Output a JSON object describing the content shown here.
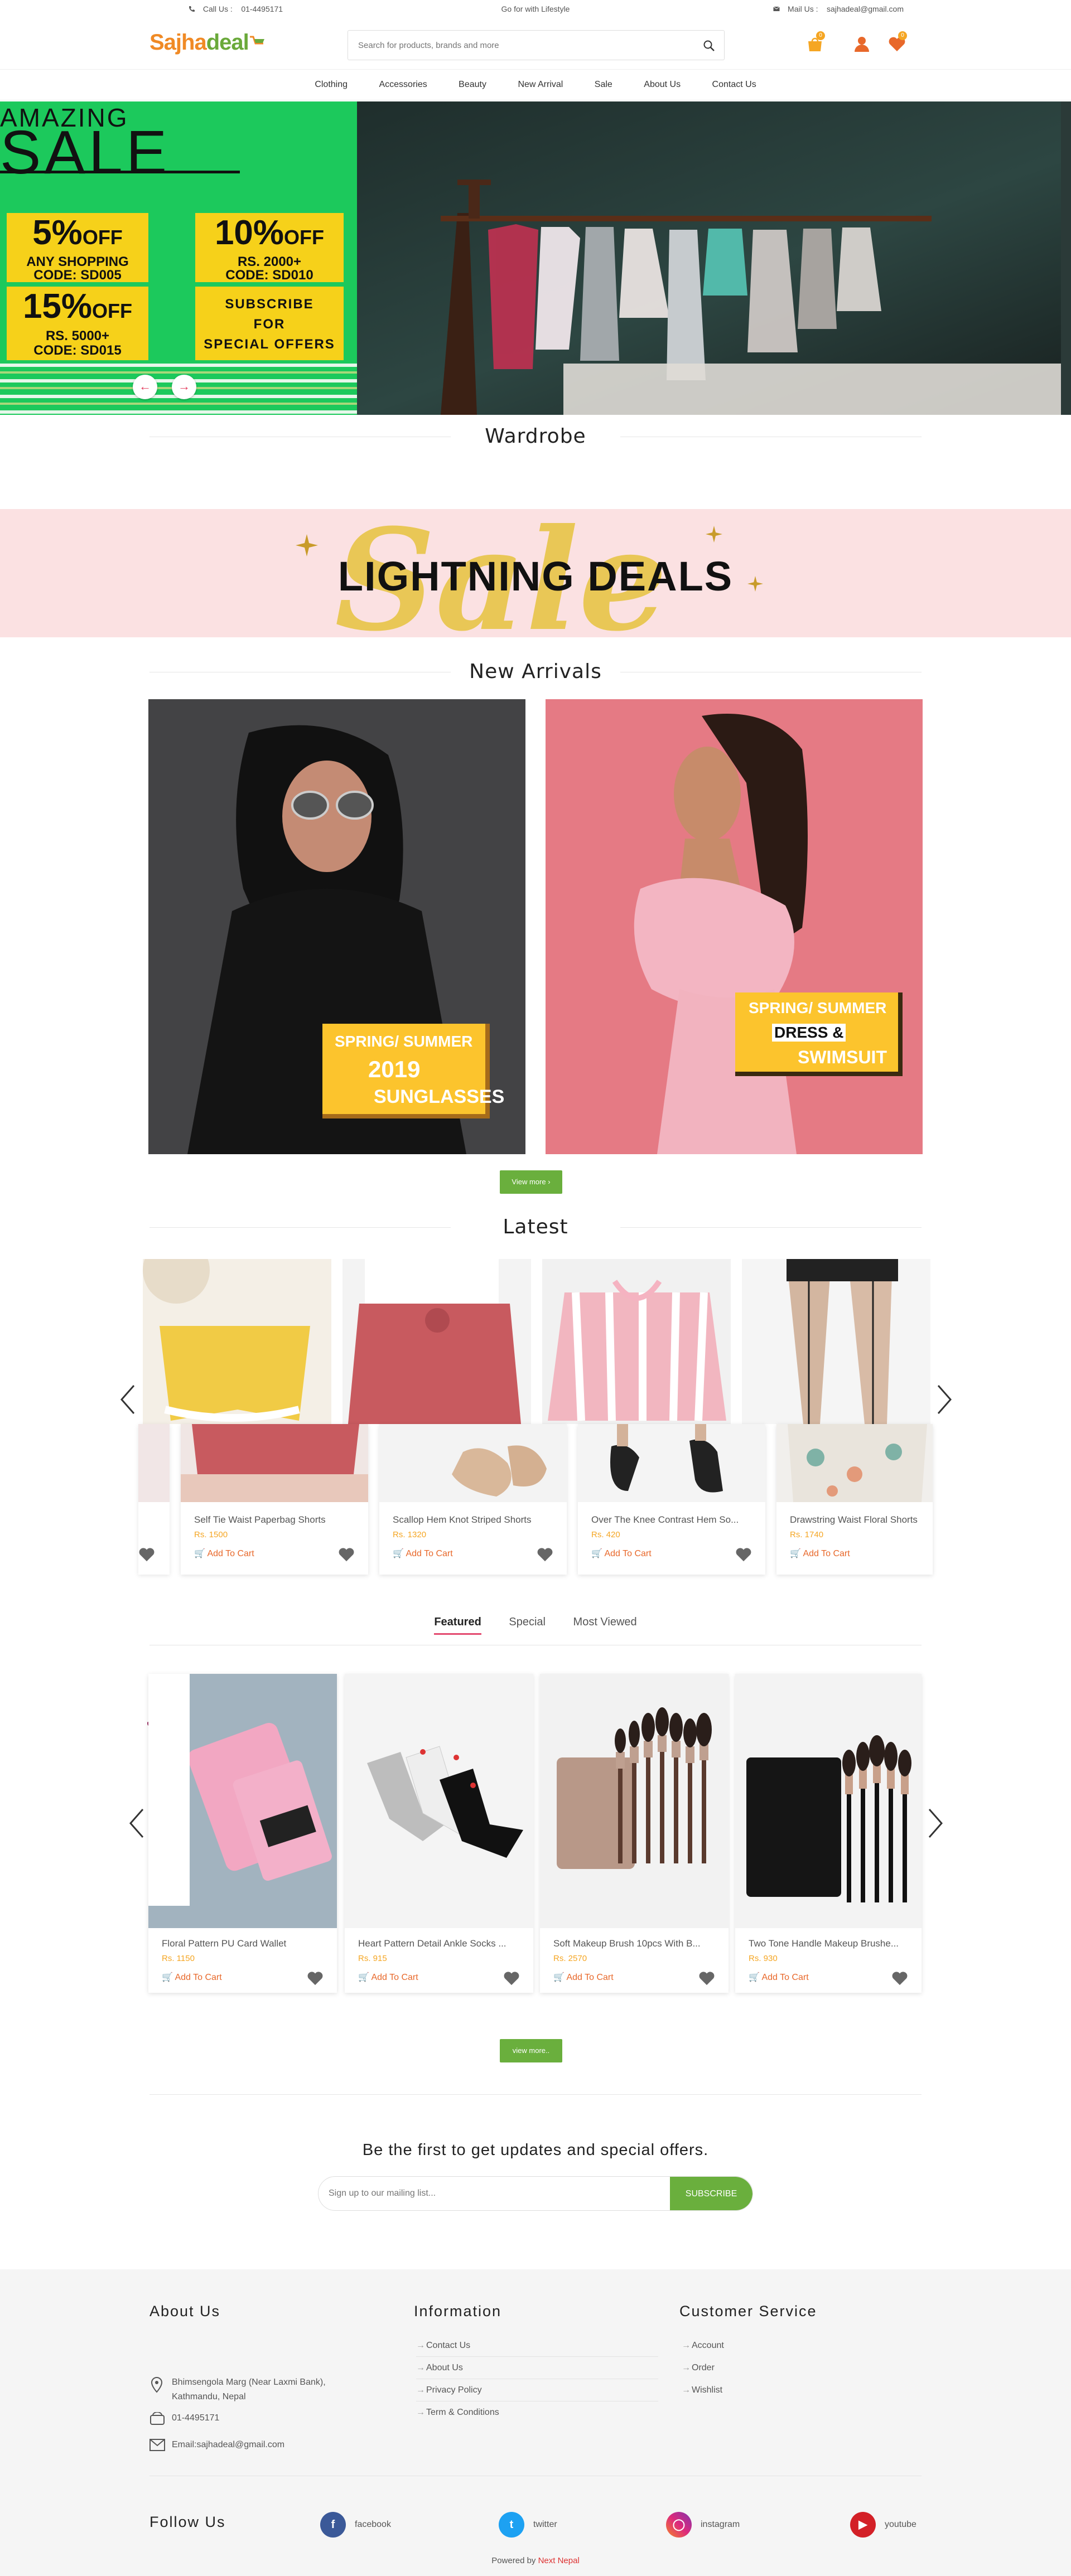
{
  "topbar": {
    "call_label": "Call Us :",
    "phone": "01-4495171",
    "tagline": "Go for with Lifestyle",
    "mail_label": "Mail Us :",
    "email": "sajhadeal@gmail.com"
  },
  "header": {
    "logo_a": "Sajha",
    "logo_b": "deal",
    "search_placeholder": "Search for products, brands and more",
    "compare_count": "0",
    "wishlist_count": "0"
  },
  "nav": [
    "Clothing",
    "Accessories",
    "Beauty",
    "New Arrival",
    "Sale",
    "About Us",
    "Contact Us"
  ],
  "hero": {
    "headline_1": "AMAZING",
    "headline_2": "SALE",
    "promo1": {
      "big": "5%",
      "off": "OFF",
      "l1": "ANY SHOPPING",
      "l2": "CODE: SD005"
    },
    "promo2": {
      "big": "10%",
      "off": "OFF",
      "l1": "RS. 2000+",
      "l2": "CODE: SD010"
    },
    "promo3": {
      "big": "15%",
      "off": "OFF",
      "l1": "RS. 5000+",
      "l2": "CODE: SD015"
    },
    "promo4": {
      "l1": "SUBSCRIBE",
      "l2": "FOR",
      "l3": "SPECIAL OFFERS"
    },
    "prev": "←",
    "next": "→"
  },
  "sections": {
    "wardrobe": "Wardrobe",
    "lightning": "LIGHTNING DEALS",
    "lightning_bg": "Sale",
    "new_arrivals": "New Arrivals",
    "latest": "Latest",
    "view_more": "View more",
    "view_more_2": "view more.."
  },
  "arrivals": [
    {
      "l1": "SPRING/ SUMMER",
      "l2": "2019",
      "l3": "SUNGLASSES"
    },
    {
      "l1": "SPRING/ SUMMER",
      "l2": "DRESS &",
      "l3": "SWIMSUIT"
    }
  ],
  "latest_products": [
    {
      "name": "Self Tie Waist Paperbag Shorts",
      "price": "Rs. 1500",
      "cart": "Add To Cart"
    },
    {
      "name": "Scallop Hem Knot Striped Shorts",
      "price": "Rs. 1320",
      "cart": "Add To Cart"
    },
    {
      "name": "Over The Knee Contrast Hem So...",
      "price": "Rs. 420",
      "cart": "Add To Cart"
    },
    {
      "name": "Drawstring Waist Floral Shorts",
      "price": "Rs. 1740",
      "cart": "Add To Cart"
    }
  ],
  "tabs": [
    "Featured",
    "Special",
    "Most Viewed"
  ],
  "featured_products": [
    {
      "name": "Floral Pattern PU Card Wallet",
      "price": "Rs. 1150",
      "cart": "Add To Cart"
    },
    {
      "name": "Heart Pattern Detail Ankle Socks ...",
      "price": "Rs. 915",
      "cart": "Add To Cart"
    },
    {
      "name": "Soft Makeup Brush 10pcs With B...",
      "price": "Rs. 2570",
      "cart": "Add To Cart"
    },
    {
      "name": "Two Tone Handle Makeup Brushe...",
      "price": "Rs. 930",
      "cart": "Add To Cart"
    }
  ],
  "newsletter": {
    "title": "Be the first to get updates and special offers.",
    "placeholder": "Sign up to our mailing list...",
    "button": "SUBSCRIBE"
  },
  "footer": {
    "about_title": "About Us",
    "address": "Bhimsengola Marg (Near Laxmi Bank),",
    "address2": "Kathmandu, Nepal",
    "phone": "01-4495171",
    "email": "Email:sajhadeal@gmail.com",
    "info_title": "Information",
    "info_links": [
      "Contact Us",
      "About Us",
      "Privacy Policy",
      "Term & Conditions"
    ],
    "cs_title": "Customer Service",
    "cs_links": [
      "Account",
      "Order",
      "Wishlist"
    ],
    "follow_title": "Follow Us",
    "social": [
      "facebook",
      "twitter",
      "instagram",
      "youtube"
    ],
    "powered_prefix": "Powered by",
    "powered_name": "Next Nepal"
  },
  "colors": {
    "brand_orange": "#f08a25",
    "brand_green": "#6aa93a",
    "accent_yellow": "#f5a623",
    "button_green": "#6aaf3d",
    "hero_green": "#1cc95c"
  }
}
